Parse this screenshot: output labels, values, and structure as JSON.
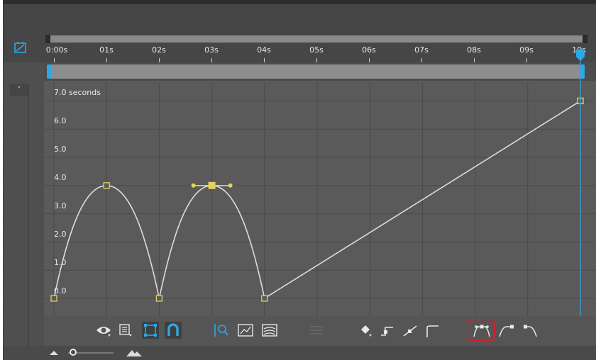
{
  "graph": {
    "duration_label": "7.0 seconds",
    "y_labels": [
      "6.0",
      "5.0",
      "4.0",
      "3.0",
      "2.0",
      "1.0",
      "0.0"
    ]
  },
  "timeline": {
    "ticks": [
      "0:00s",
      "01s",
      "02s",
      "03s",
      "04s",
      "05s",
      "06s",
      "07s",
      "08s",
      "09s",
      "10s"
    ]
  },
  "curve": {
    "keyframes": [
      {
        "t": 0.0,
        "v": 0.0
      },
      {
        "t": 1.0,
        "v": 4.0
      },
      {
        "t": 2.0,
        "v": 0.0
      },
      {
        "t": 3.0,
        "v": 4.0,
        "selected": true
      },
      {
        "t": 4.0,
        "v": 0.0
      },
      {
        "t": 10.0,
        "v": 7.0
      }
    ]
  },
  "toolbar": {
    "icons": [
      "eye-icon",
      "graph-type-icon",
      "transform-box-icon",
      "snap-icon",
      "fit-selection-icon",
      "fit-all-icon",
      "graph-editor-icon",
      "separate-dimensions-icon",
      "convert-keyframe-icon",
      "hold-keyframe-icon",
      "linear-keyframe-icon",
      "auto-bezier-icon",
      "easy-ease-icon",
      "easy-ease-in-icon",
      "easy-ease-out-icon"
    ]
  },
  "colors": {
    "panel": "#5a5a5a",
    "grid": "#4a4a4a",
    "curve": "#dcdcdc",
    "keyframe": "#e5d35a",
    "playhead": "#2ea7e6",
    "highlight": "#d21f2c"
  }
}
